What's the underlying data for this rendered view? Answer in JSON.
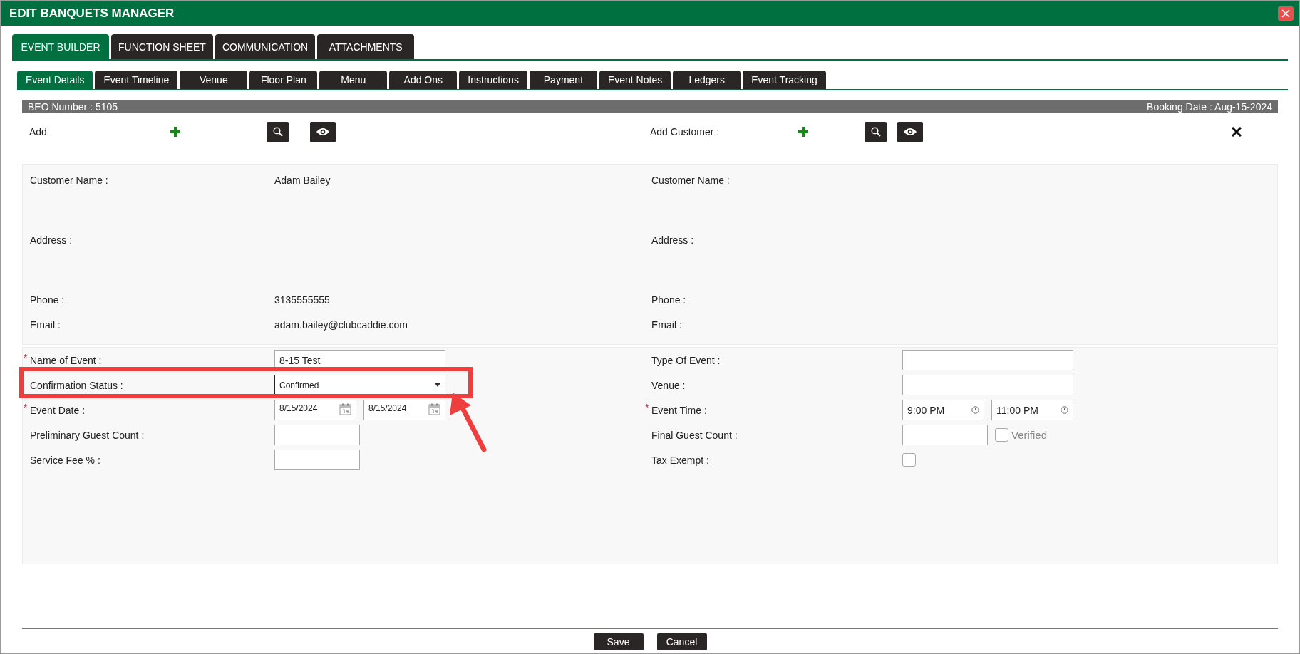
{
  "window": {
    "title": "EDIT BANQUETS MANAGER"
  },
  "main_tabs": [
    {
      "label": "EVENT BUILDER",
      "selected": true
    },
    {
      "label": "FUNCTION SHEET",
      "selected": false
    },
    {
      "label": "COMMUNICATION",
      "selected": false
    },
    {
      "label": "ATTACHMENTS",
      "selected": false
    }
  ],
  "sub_tabs": [
    {
      "label": "Event Details",
      "selected": true
    },
    {
      "label": "Event Timeline",
      "selected": false
    },
    {
      "label": "Venue",
      "selected": false
    },
    {
      "label": "Floor Plan",
      "selected": false
    },
    {
      "label": "Menu",
      "selected": false
    },
    {
      "label": "Add Ons",
      "selected": false
    },
    {
      "label": "Instructions",
      "selected": false
    },
    {
      "label": "Payment",
      "selected": false
    },
    {
      "label": "Event Notes",
      "selected": false
    },
    {
      "label": "Ledgers",
      "selected": false
    },
    {
      "label": "Event Tracking",
      "selected": false
    }
  ],
  "header_bar": {
    "beo_number": "BEO Number : 5105",
    "booking_date": "Booking Date : Aug-15-2024"
  },
  "add_row": {
    "left_label": "Add",
    "right_label": "Add Customer :"
  },
  "customer": {
    "left": [
      {
        "kind": "block",
        "label": "Customer Name :",
        "value": "Adam Bailey"
      },
      {
        "kind": "block",
        "label": "Address :"
      },
      {
        "kind": "line",
        "label": "Phone  :",
        "value": "3135555555"
      },
      {
        "kind": "line",
        "label": "Email :",
        "value": "adam.bailey@clubcaddie.com"
      }
    ],
    "right": [
      {
        "kind": "block",
        "label": "Customer Name  :"
      },
      {
        "kind": "block",
        "label": "Address  :"
      },
      {
        "kind": "line",
        "label": "Phone  :"
      },
      {
        "kind": "line",
        "label": "Email  :"
      }
    ]
  },
  "form": {
    "required_mark": "*",
    "left": [
      {
        "kind": "text",
        "required": true,
        "label": "Name of Event :",
        "value": "8-15 Test"
      },
      {
        "kind": "select",
        "required": false,
        "label": "Confirmation Status :",
        "value": "Confirmed"
      },
      {
        "kind": "date_range",
        "required": true,
        "label": "Event Date :",
        "values": [
          "8/15/2024",
          "8/15/2024"
        ]
      },
      {
        "kind": "short",
        "required": false,
        "label": "Preliminary Guest Count :"
      },
      {
        "kind": "short",
        "required": false,
        "label": "Service Fee % :"
      }
    ],
    "right": [
      {
        "kind": "text",
        "required": false,
        "label": "Type Of Event :"
      },
      {
        "kind": "text",
        "required": false,
        "label": "Venue :"
      },
      {
        "kind": "time_range",
        "required": true,
        "label": "Event Time :",
        "values": [
          "9:00 PM",
          "11:00 PM"
        ]
      },
      {
        "kind": "short_check",
        "required": false,
        "label": "Final Guest Count :",
        "check_label": "Verified",
        "checked": false
      },
      {
        "kind": "checkbox",
        "required": false,
        "label": "Tax Exempt :",
        "checked": false
      }
    ]
  },
  "annotation": {
    "kind": "highlight_box"
  },
  "buttons": [
    "Save",
    "Cancel"
  ]
}
